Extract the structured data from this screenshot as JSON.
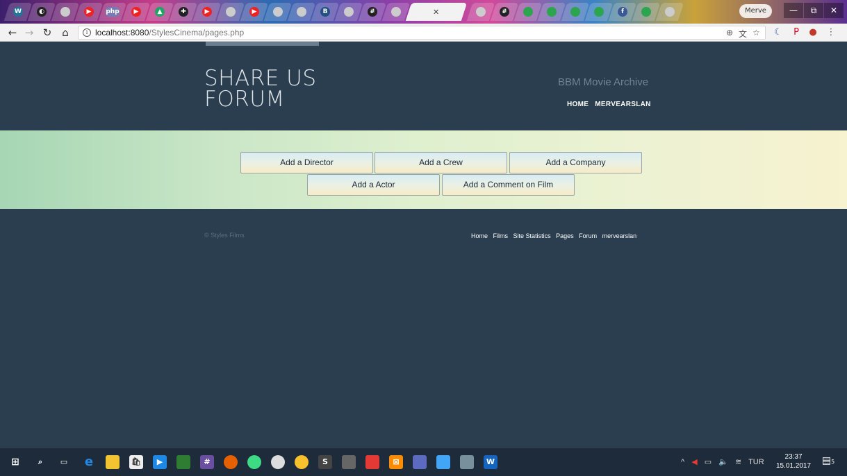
{
  "browser": {
    "url_host": "localhost:8080",
    "url_path": "/StylesCinema/pages.php",
    "profile_name": "Merve",
    "tab_icons": [
      "wordpress-icon",
      "github-icon",
      "page-icon",
      "youtube-icon",
      "php-icon",
      "youtube-icon",
      "drive-icon",
      "slack-icon",
      "youtube-icon",
      "page-icon",
      "youtube-icon",
      "page-icon",
      "page-icon",
      "bitbucket-icon",
      "page-icon",
      "slack-icon",
      "page-icon",
      "chrome-icon",
      "page-icon"
    ],
    "window_controls": {
      "minimize": "—",
      "maximize": "⧉",
      "close": "✕"
    }
  },
  "header": {
    "title_line1": "SHARE US",
    "title_line2": "FORUM",
    "subtitle": "BBM Movie Archive",
    "nav": [
      "HOME",
      "MERVEARSLAN"
    ]
  },
  "actions": {
    "row1": [
      "Add a Director",
      "Add a Crew",
      "Add a Company"
    ],
    "row2": [
      "Add a Actor",
      "Add a Comment on Film"
    ]
  },
  "footer": {
    "copyright": "© Styles Films",
    "nav": [
      "Home",
      "Films",
      "Site Statistics",
      "Pages",
      "Forum",
      "mervearslan"
    ]
  },
  "taskbar": {
    "language": "TUR",
    "time": "23:37",
    "date": "15.01.2017",
    "notification_count": "5"
  },
  "colors": {
    "page_bg": "#2b3e4f",
    "banner_start": "#a6d6b4",
    "banner_end": "#f7f2d0"
  }
}
